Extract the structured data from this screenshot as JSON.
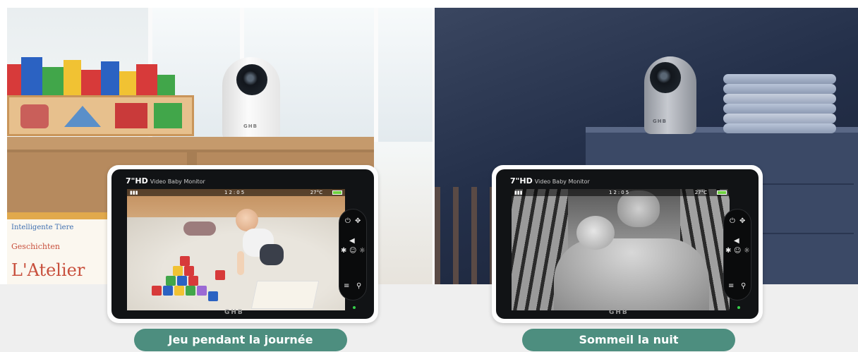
{
  "scenes": [
    {
      "id": "day",
      "monitor": {
        "model": "7\"HD",
        "subtitle": "Video Baby Monitor",
        "time": "12:05",
        "temperature": "27°C",
        "brand": "GHB"
      },
      "camera_brand": "GHB",
      "books": [
        "Intelligente Tiere",
        "Geschichten",
        "L'Atelier"
      ],
      "caption": "Jeu pendant la journée"
    },
    {
      "id": "night",
      "monitor": {
        "model": "7\"HD",
        "subtitle": "Video Baby Monitor",
        "time": "12:05",
        "temperature": "27°C",
        "brand": "GHB"
      },
      "camera_brand": "GHB",
      "caption": "Sommeil la nuit"
    }
  ],
  "colors": {
    "caption_bg": "#4d8e7f",
    "caption_text": "#ffffff",
    "battery": "#6ed13e",
    "led": "#35d04a"
  },
  "icons": [
    "power-icon",
    "dpad-icon",
    "volume-icon",
    "brightness-icon",
    "menu-icon",
    "microphone-icon",
    "baby-face-icon"
  ]
}
